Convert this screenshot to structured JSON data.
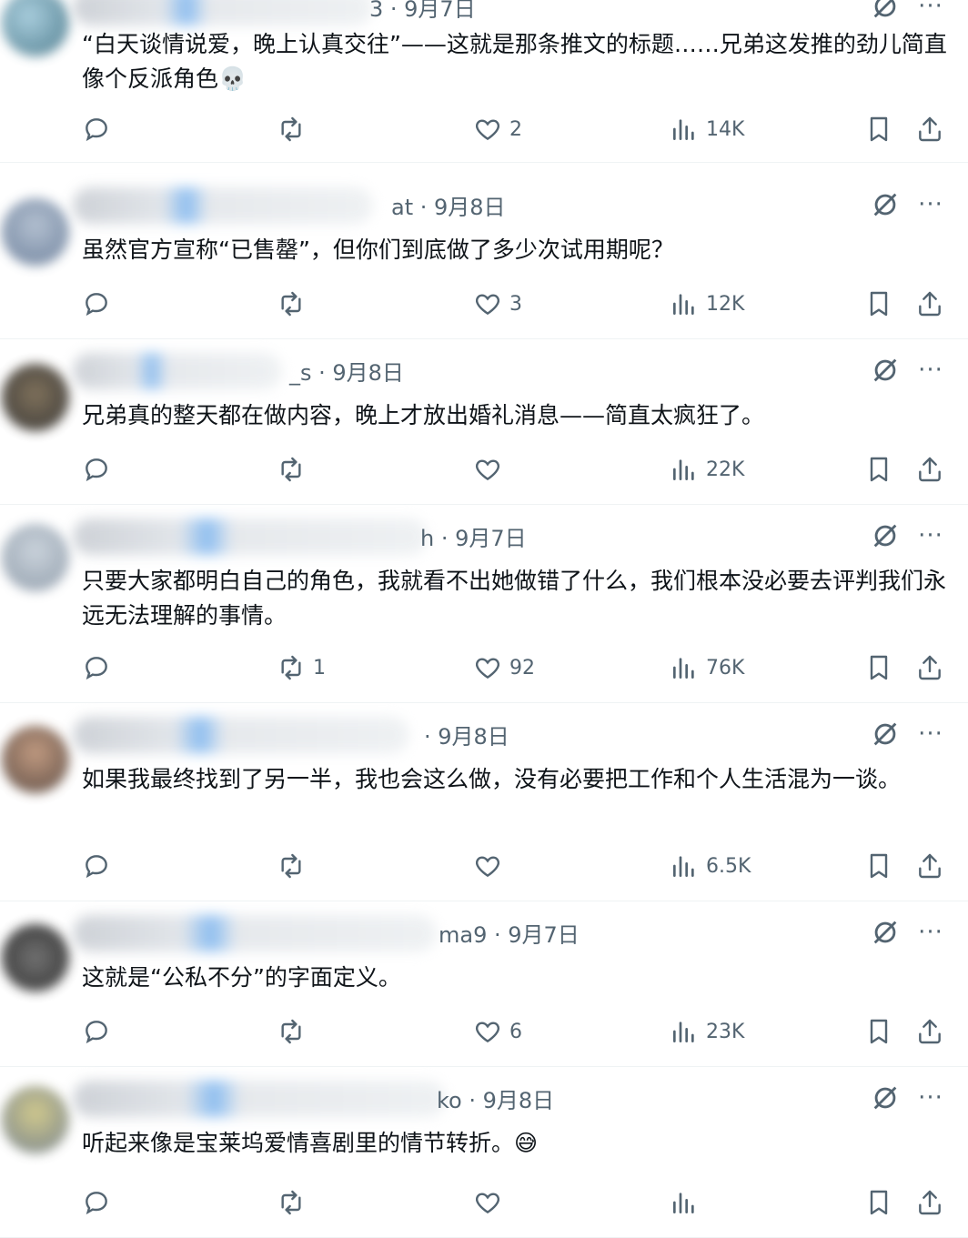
{
  "posts": [
    {
      "handle_tail": "3 · 9月7日",
      "text": "“白天谈情说爱，晚上认真交往”——这就是那条推文的标题……兄弟这发推的劲儿简直像个反派角色💀",
      "replies": "",
      "retweets": "",
      "likes": "2",
      "views": "14K"
    },
    {
      "handle_tail": "at · 9月8日",
      "text": "虽然官方宣称“已售罄”，但你们到底做了多少次试用期呢？",
      "replies": "",
      "retweets": "",
      "likes": "3",
      "views": "12K"
    },
    {
      "handle_tail": "_s · 9月8日",
      "text": "兄弟真的整天都在做内容，晚上才放出婚礼消息——简直太疯狂了。",
      "replies": "",
      "retweets": "",
      "likes": "",
      "views": "22K"
    },
    {
      "handle_tail": "h · 9月7日",
      "text": "只要大家都明白自己的角色，我就看不出她做错了什么，我们根本没必要去评判我们永远无法理解的事情。",
      "replies": "",
      "retweets": "1",
      "likes": "92",
      "views": "76K"
    },
    {
      "handle_tail": "· 9月8日",
      "text": "如果我最终找到了另一半，我也会这么做，没有必要把工作和个人生活混为一谈。",
      "replies": "",
      "retweets": "",
      "likes": "",
      "views": "6.5K"
    },
    {
      "handle_tail": "ma9 · 9月7日",
      "text": "这就是“公私不分”的字面定义。",
      "replies": "",
      "retweets": "",
      "likes": "6",
      "views": "23K"
    },
    {
      "handle_tail": "ko · 9月8日",
      "text": "听起来像是宝莱坞爱情喜剧里的情节转折。😅",
      "replies": "",
      "retweets": "",
      "likes": "",
      "views": ""
    }
  ],
  "icons": {
    "reply": "reply-icon",
    "retweet": "retweet-icon",
    "like": "heart-icon",
    "views": "views-icon",
    "bookmark": "bookmark-icon",
    "share": "share-icon",
    "grok": "grok-icon",
    "more": "more-icon"
  },
  "colors": {
    "text": "#0f1419",
    "secondary": "#536471",
    "divider": "#eff3f4",
    "verified": "#1d9bf0"
  }
}
